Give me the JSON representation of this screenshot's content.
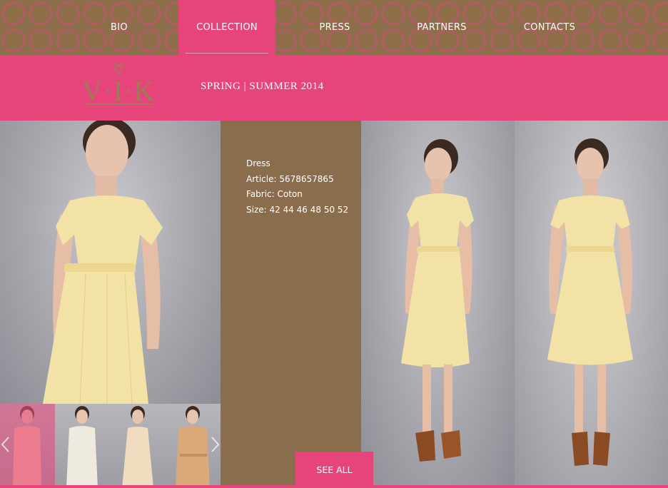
{
  "nav": {
    "items": [
      {
        "label": "BIO",
        "active": false
      },
      {
        "label": "COLLECTION",
        "active": true
      },
      {
        "label": "PRESS",
        "active": false
      },
      {
        "label": "PARTNERS",
        "active": false
      },
      {
        "label": "CONTACTS",
        "active": false
      }
    ]
  },
  "brand": {
    "logo_text": "V·I·K",
    "season": "SPRING | SUMMER 2014"
  },
  "product": {
    "name": "Dress",
    "article": "Article: 5678657865",
    "fabric": "Fabric: Coton",
    "size": "Size: 42 44 46 48 50 52"
  },
  "see_all_label": "SEE ALL",
  "thumbnails": [
    {
      "dress_color": "#f4c4a8",
      "active": true
    },
    {
      "dress_color": "#eeeadf",
      "active": false
    },
    {
      "dress_color": "#f2dcc0",
      "active": false
    },
    {
      "dress_color": "#d9a97a",
      "active": false
    }
  ],
  "colors": {
    "accent_pink": "#e6447a",
    "brown": "#8a6d4d",
    "dress_yellow": "#f3e2a6"
  }
}
